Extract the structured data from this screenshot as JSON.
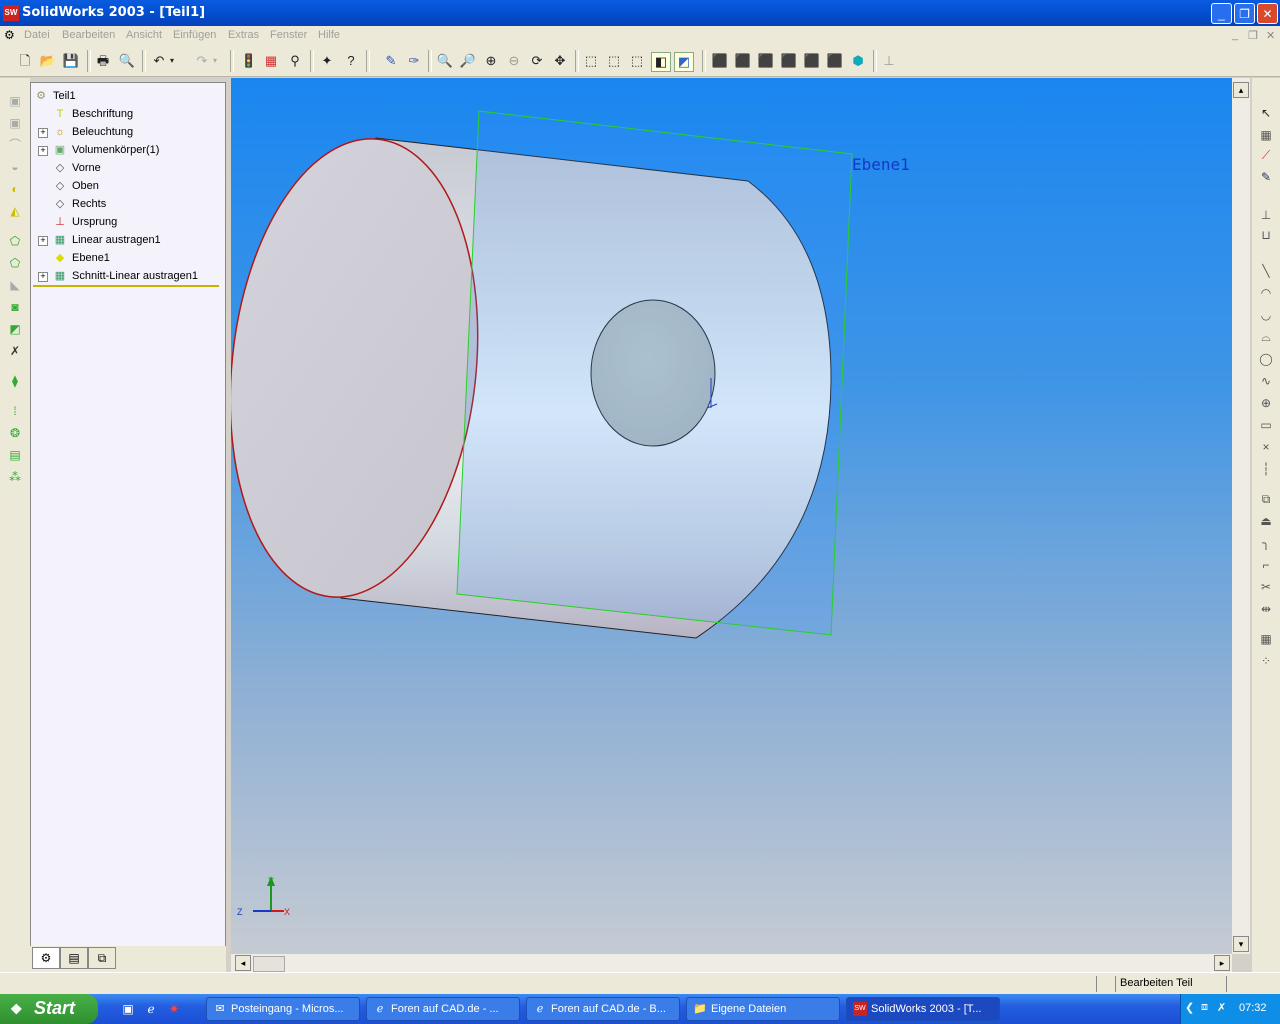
{
  "window": {
    "title": "SolidWorks 2003 - [Teil1]",
    "app_icon": "SW"
  },
  "menu": [
    "Datei",
    "Bearbeiten",
    "Ansicht",
    "Einfügen",
    "Extras",
    "Fenster",
    "Hilfe"
  ],
  "tree": {
    "root": "Teil1",
    "items": [
      {
        "label": "Beschriftung",
        "icon": "annotation-icon",
        "expandable": false
      },
      {
        "label": "Beleuchtung",
        "icon": "lighting-icon",
        "expandable": true
      },
      {
        "label": "Volumenkörper(1)",
        "icon": "solid-bodies-icon",
        "expandable": true
      },
      {
        "label": "Vorne",
        "icon": "plane-icon",
        "expandable": false
      },
      {
        "label": "Oben",
        "icon": "plane-icon",
        "expandable": false
      },
      {
        "label": "Rechts",
        "icon": "plane-icon",
        "expandable": false
      },
      {
        "label": "Ursprung",
        "icon": "origin-icon",
        "expandable": false
      },
      {
        "label": "Linear austragen1",
        "icon": "extrude-icon",
        "expandable": true
      },
      {
        "label": "Ebene1",
        "icon": "plane-selected-icon",
        "expandable": false
      },
      {
        "label": "Schnitt-Linear austragen1",
        "icon": "cut-extrude-icon",
        "expandable": true
      }
    ]
  },
  "viewport": {
    "plane_label": "Ebene1",
    "axis_x": "X",
    "axis_y": "Y",
    "axis_z": "Z"
  },
  "status": {
    "text": "Bearbeiten Teil"
  },
  "taskbar": {
    "start_label": "Start",
    "buttons": [
      {
        "label": "Posteingang - Micros...",
        "icon": "outlook-icon"
      },
      {
        "label": "Foren auf CAD.de - ...",
        "icon": "ie-icon"
      },
      {
        "label": "Foren auf CAD.de - B...",
        "icon": "ie-icon"
      },
      {
        "label": "Eigene Dateien",
        "icon": "folder-icon"
      },
      {
        "label": "SolidWorks 2003 - [T...",
        "icon": "solidworks-icon"
      }
    ],
    "clock": "07:32"
  }
}
